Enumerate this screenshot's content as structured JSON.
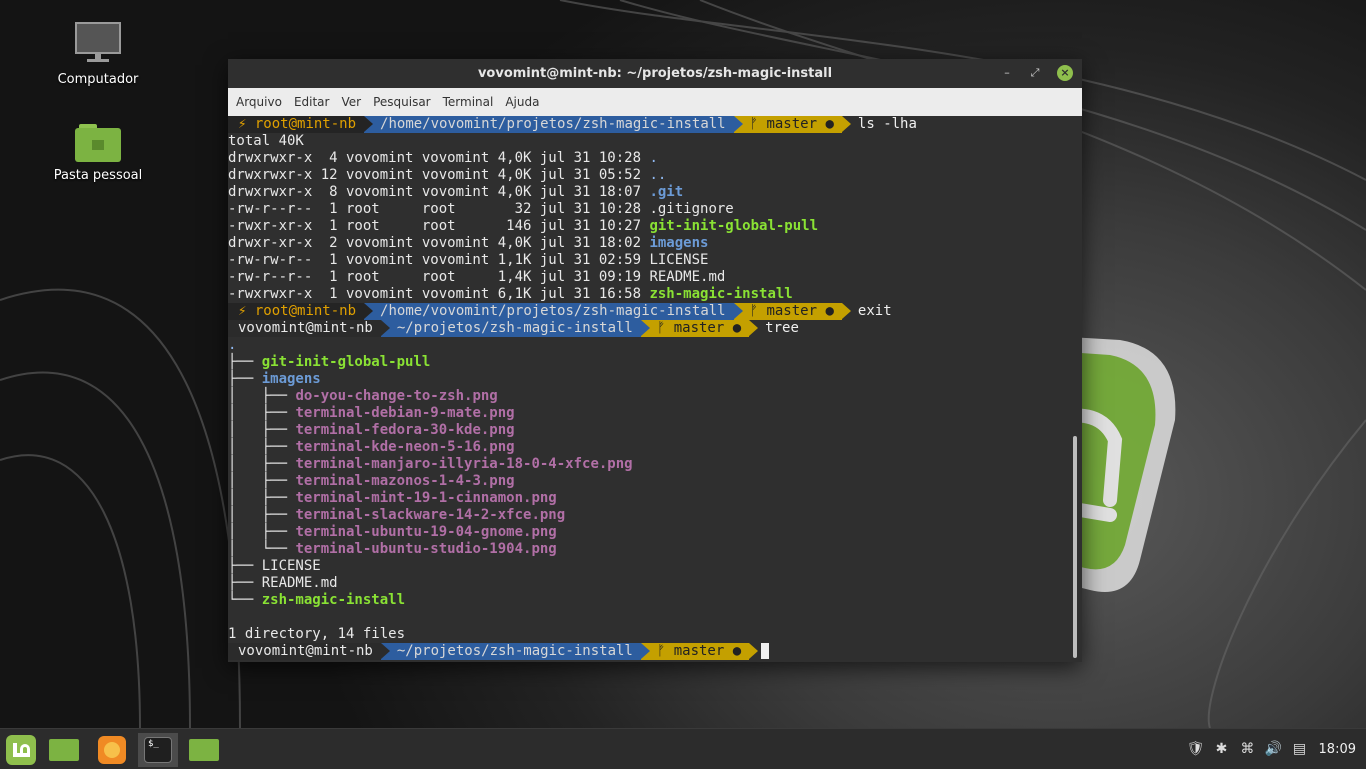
{
  "desktop": {
    "icons": [
      {
        "label": "Computador"
      },
      {
        "label": "Pasta pessoal"
      }
    ]
  },
  "window": {
    "title": "vovomint@mint-nb: ~/projetos/zsh-magic-install",
    "menu": [
      "Arquivo",
      "Editar",
      "Ver",
      "Pesquisar",
      "Terminal",
      "Ajuda"
    ]
  },
  "terminal": {
    "prompt_root": {
      "user": "root@mint-nb",
      "bolt": "⚡",
      "path": "/home/vovomint/projetos/zsh-magic-install",
      "branch": "master"
    },
    "prompt_user": {
      "user": "vovomint@mint-nb",
      "path": "~/projetos/zsh-magic-install",
      "branch": "master"
    },
    "branch_icon": "ᚠ",
    "dirty_mark": "●",
    "cmd1": "ls -lha",
    "total": "total 40K",
    "listing": [
      {
        "meta": "drwxrwxr-x  4 vovomint vovomint 4,0K jul 31 10:28 ",
        "name": ".",
        "kind": "sel"
      },
      {
        "meta": "drwxrwxr-x 12 vovomint vovomint 4,0K jul 31 05:52 ",
        "name": "..",
        "kind": "sel"
      },
      {
        "meta": "drwxrwxr-x  8 vovomint vovomint 4,0K jul 31 18:07 ",
        "name": ".git",
        "kind": "dir"
      },
      {
        "meta": "-rw-r--r--  1 root     root       32 jul 31 10:28 ",
        "name": ".gitignore",
        "kind": "file"
      },
      {
        "meta": "-rwxr-xr-x  1 root     root      146 jul 31 10:27 ",
        "name": "git-init-global-pull",
        "kind": "exe"
      },
      {
        "meta": "drwxr-xr-x  2 vovomint vovomint 4,0K jul 31 18:02 ",
        "name": "imagens",
        "kind": "dir"
      },
      {
        "meta": "-rw-rw-r--  1 vovomint vovomint 1,1K jul 31 02:59 ",
        "name": "LICENSE",
        "kind": "file"
      },
      {
        "meta": "-rw-r--r--  1 root     root     1,4K jul 31 09:19 ",
        "name": "README.md",
        "kind": "file"
      },
      {
        "meta": "-rwxrwxr-x  1 vovomint vovomint 6,1K jul 31 16:58 ",
        "name": "zsh-magic-install",
        "kind": "exe"
      }
    ],
    "cmd2": "exit",
    "cmd3": "tree",
    "tree": [
      {
        "prefix": ".",
        "name": "",
        "kind": "sel"
      },
      {
        "prefix": "├── ",
        "name": "git-init-global-pull",
        "kind": "exe"
      },
      {
        "prefix": "├── ",
        "name": "imagens",
        "kind": "dir"
      },
      {
        "prefix": "│   ├── ",
        "name": "do-you-change-to-zsh.png",
        "kind": "png"
      },
      {
        "prefix": "│   ├── ",
        "name": "terminal-debian-9-mate.png",
        "kind": "png"
      },
      {
        "prefix": "│   ├── ",
        "name": "terminal-fedora-30-kde.png",
        "kind": "png"
      },
      {
        "prefix": "│   ├── ",
        "name": "terminal-kde-neon-5-16.png",
        "kind": "png"
      },
      {
        "prefix": "│   ├── ",
        "name": "terminal-manjaro-illyria-18-0-4-xfce.png",
        "kind": "png"
      },
      {
        "prefix": "│   ├── ",
        "name": "terminal-mazonos-1-4-3.png",
        "kind": "png"
      },
      {
        "prefix": "│   ├── ",
        "name": "terminal-mint-19-1-cinnamon.png",
        "kind": "png"
      },
      {
        "prefix": "│   ├── ",
        "name": "terminal-slackware-14-2-xfce.png",
        "kind": "png"
      },
      {
        "prefix": "│   ├── ",
        "name": "terminal-ubuntu-19-04-gnome.png",
        "kind": "png"
      },
      {
        "prefix": "│   └── ",
        "name": "terminal-ubuntu-studio-1904.png",
        "kind": "png"
      },
      {
        "prefix": "├── ",
        "name": "LICENSE",
        "kind": "file"
      },
      {
        "prefix": "├── ",
        "name": "README.md",
        "kind": "file"
      },
      {
        "prefix": "└── ",
        "name": "zsh-magic-install",
        "kind": "exe"
      },
      {
        "prefix": "",
        "name": "",
        "kind": "file"
      }
    ],
    "summary": "1 directory, 14 files"
  },
  "taskbar": {
    "clock": "18:09"
  },
  "colors": {
    "accent": "#8fbf4d",
    "path_segment": "#2d5d9f",
    "git_segment": "#c4a000"
  }
}
